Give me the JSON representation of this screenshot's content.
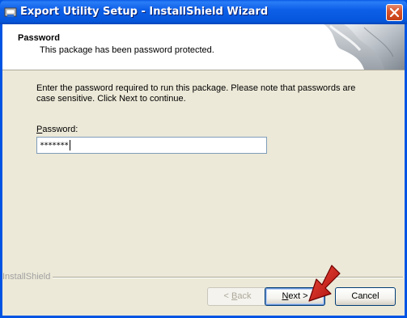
{
  "window": {
    "title": "Export Utility Setup - InstallShield Wizard",
    "icons": {
      "app": "installer-icon",
      "close": "close-icon"
    }
  },
  "banner": {
    "title": "Password",
    "subtitle": "This package has been password protected."
  },
  "body": {
    "instructions": "Enter the password required to run this package.  Please note that passwords are case sensitive.  Click Next to continue.",
    "password_label_access": "P",
    "password_label_rest": "assword:",
    "password_value": "*******"
  },
  "footer": {
    "brand": "InstallShield",
    "back_access": "B",
    "back_pre": "< ",
    "back_post": "ack",
    "next_access": "N",
    "next_post": "ext >",
    "cancel_label": "Cancel",
    "arrow_icon": "red-pointer-arrow-icon"
  },
  "colors": {
    "title_bar": "#0055e5",
    "dialog_bg": "#ece9d8",
    "arrow": "#d4201a"
  }
}
